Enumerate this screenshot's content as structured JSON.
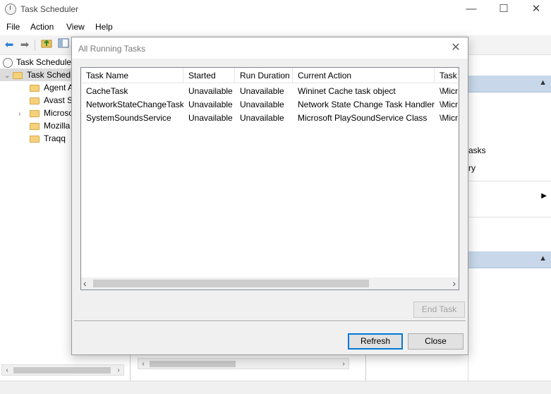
{
  "window": {
    "title": "Task Scheduler",
    "minimize_glyph": "—",
    "maximize_glyph": "☐",
    "close_glyph": "✕"
  },
  "menu": [
    "File",
    "Action",
    "View",
    "Help"
  ],
  "toolbar": {
    "back_glyph": "⬅",
    "forward_glyph": "➡"
  },
  "tree": {
    "root": "Task Scheduler",
    "library": "Task Sched",
    "folders": [
      {
        "label": "Agent A",
        "expandable": false
      },
      {
        "label": "Avast S",
        "expandable": false
      },
      {
        "label": "Microso",
        "expandable": true
      },
      {
        "label": "Mozilla",
        "expandable": false
      },
      {
        "label": "Traqq",
        "expandable": false
      }
    ]
  },
  "right_panel": {
    "items": [
      "asks",
      "ry"
    ]
  },
  "dialog": {
    "title": "All Running Tasks",
    "close_glyph": "✕",
    "columns": [
      "Task Name",
      "Started",
      "Run Duration",
      "Current Action",
      "Task F"
    ],
    "rows": [
      [
        "CacheTask",
        "Unavailable",
        "Unavailable",
        "Wininet Cache task object",
        "\\Micr"
      ],
      [
        "NetworkStateChangeTask",
        "Unavailable",
        "Unavailable",
        "Network State Change Task Handler",
        "\\Micr"
      ],
      [
        "SystemSoundsService",
        "Unavailable",
        "Unavailable",
        "Microsoft PlaySoundService Class",
        "\\Micr"
      ]
    ],
    "end_task_label": "End Task",
    "refresh_label": "Refresh",
    "close_label": "Close",
    "scroll_left_glyph": "‹",
    "scroll_right_glyph": "›"
  },
  "colors": {
    "accent": "#0078d7",
    "panel_header": "#c8d8ea"
  }
}
